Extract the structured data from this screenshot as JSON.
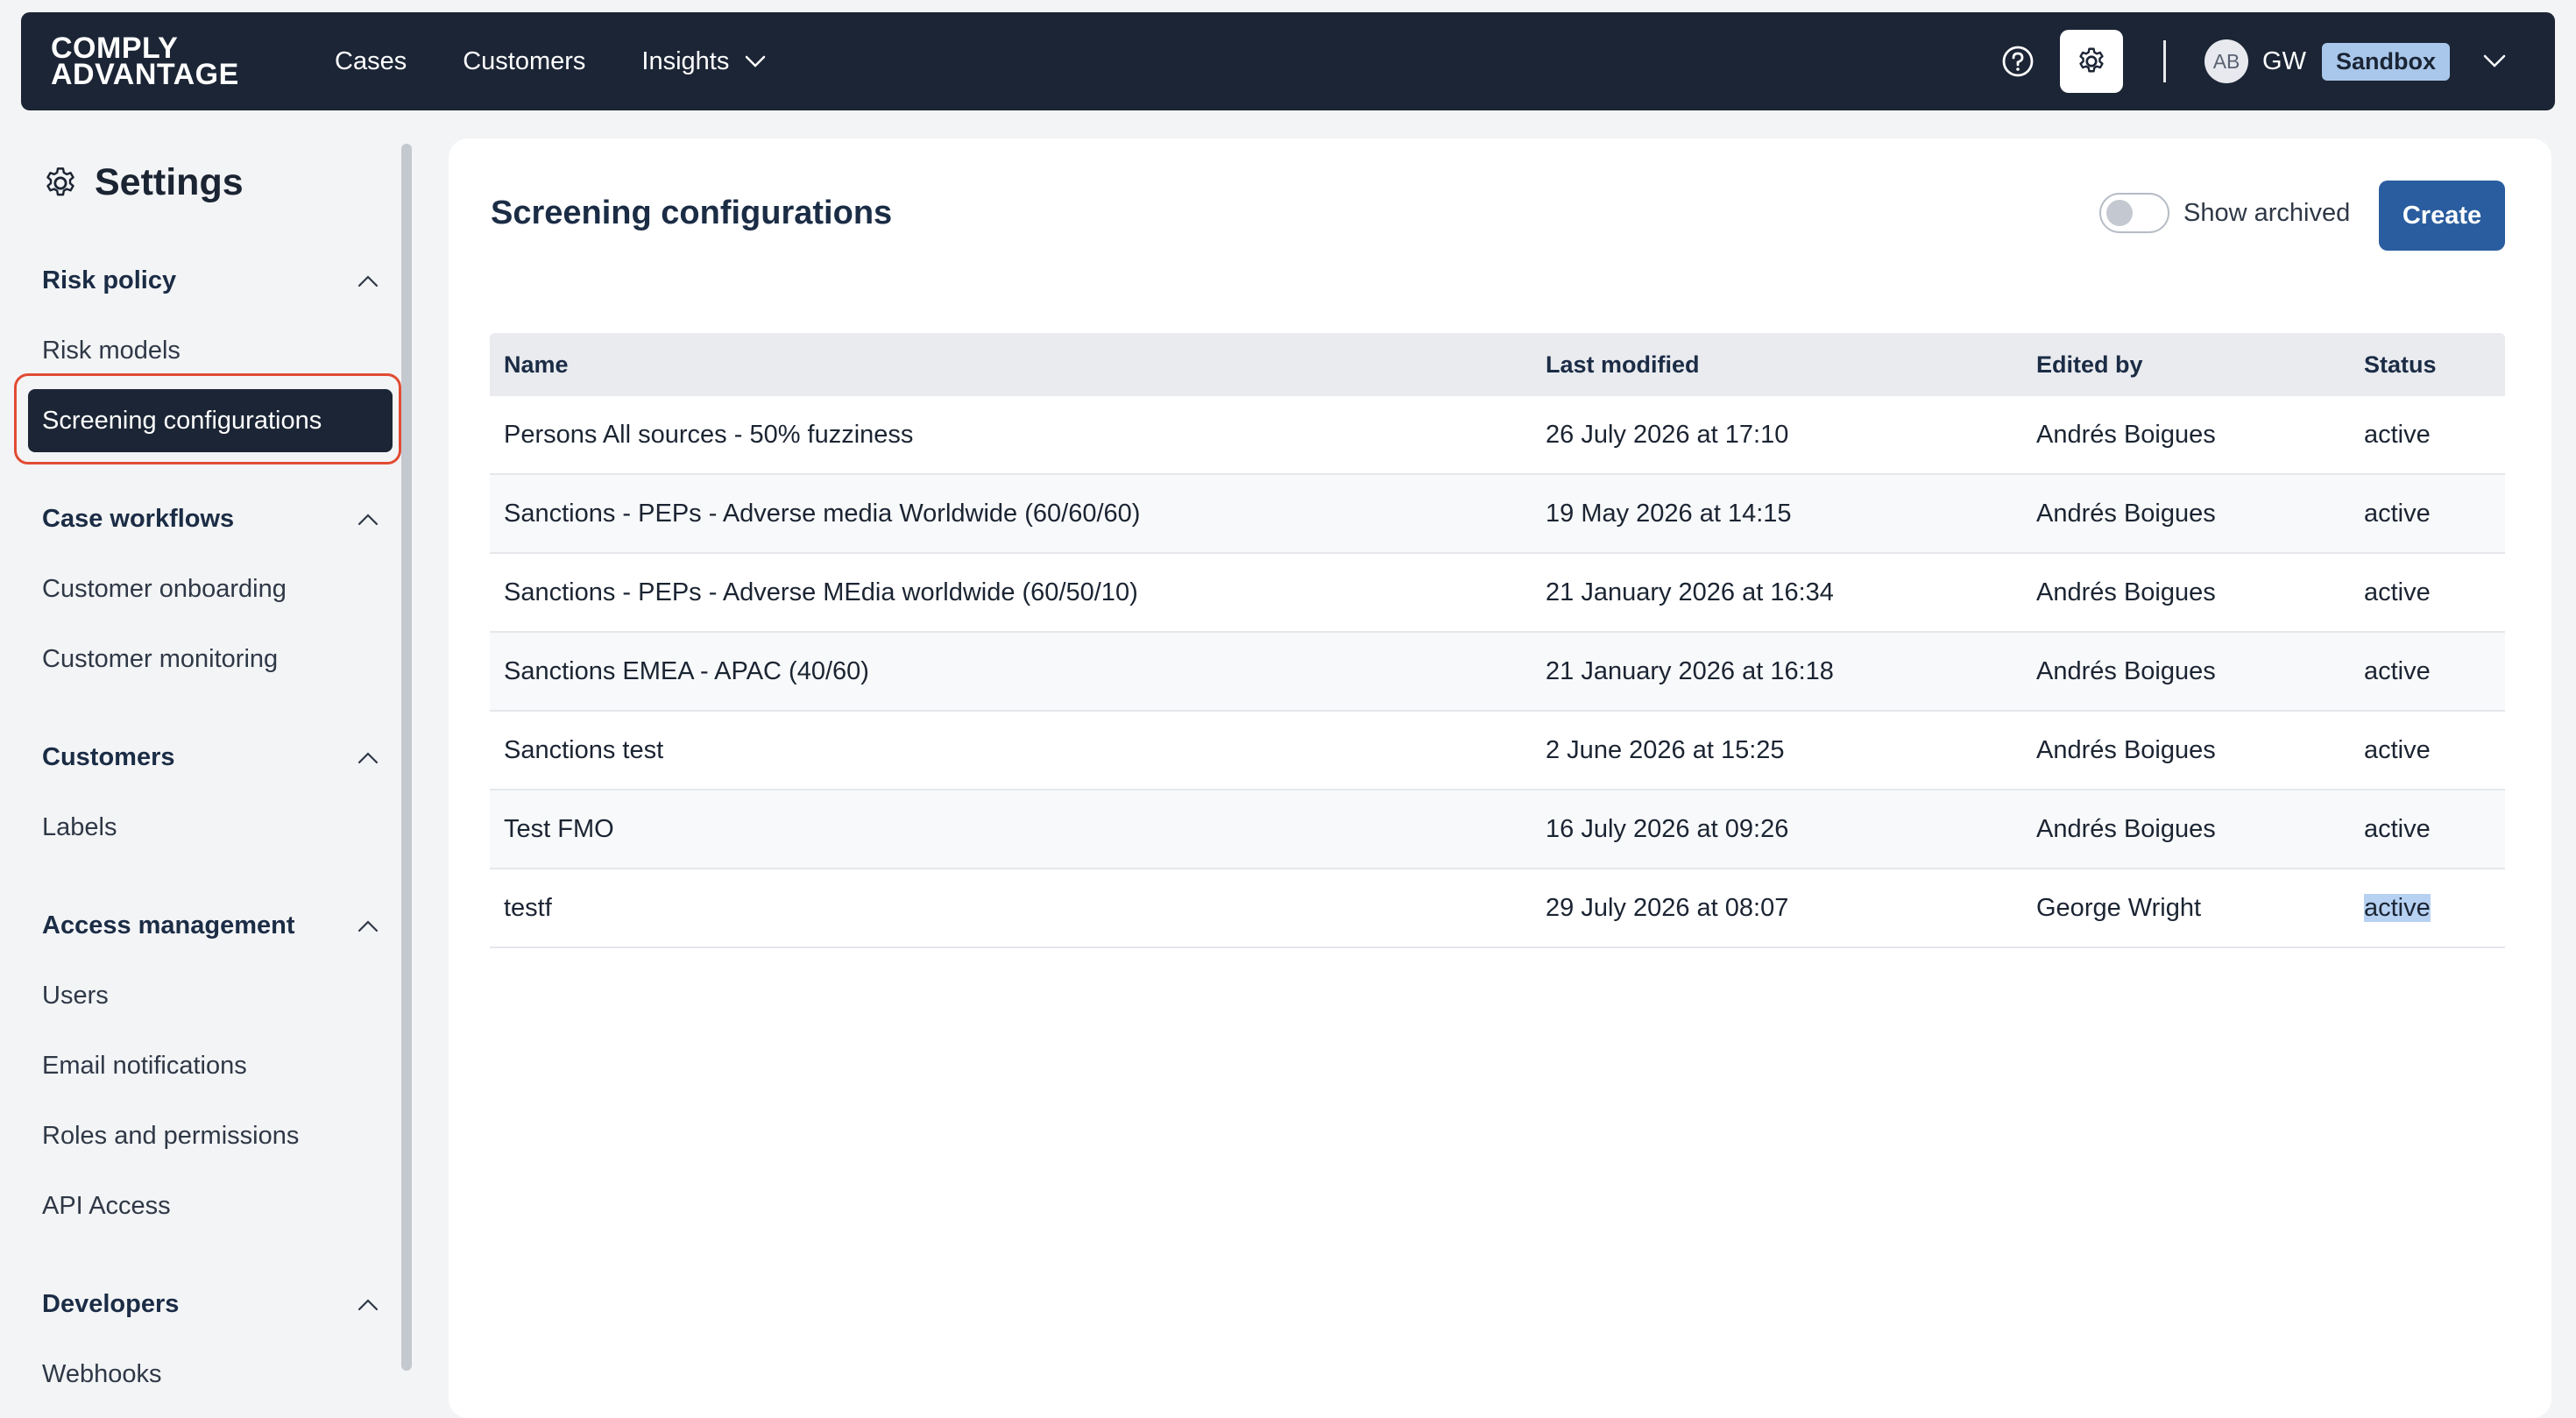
{
  "header": {
    "logo_line1": "COMPLY",
    "logo_line2": "ADVANTAGE",
    "nav": [
      {
        "label": "Cases"
      },
      {
        "label": "Customers"
      },
      {
        "label": "Insights"
      }
    ],
    "help_icon": "help-circle-icon",
    "settings_icon": "gear-icon",
    "user": {
      "avatar_initials": "AB",
      "initials": "GW",
      "environment": "Sandbox"
    }
  },
  "sidebar": {
    "title": "Settings",
    "sections": [
      {
        "label": "Risk policy",
        "items": [
          "Risk models",
          "Screening configurations"
        ]
      },
      {
        "label": "Case workflows",
        "items": [
          "Customer onboarding",
          "Customer monitoring"
        ]
      },
      {
        "label": "Customers",
        "items": [
          "Labels"
        ]
      },
      {
        "label": "Access management",
        "items": [
          "Users",
          "Email notifications",
          "Roles and permissions",
          "API Access"
        ]
      },
      {
        "label": "Developers",
        "items": [
          "Webhooks"
        ]
      }
    ],
    "selected_item": "Screening configurations"
  },
  "main": {
    "title": "Screening configurations",
    "show_archived_label": "Show archived",
    "show_archived": false,
    "create_label": "Create",
    "table": {
      "columns": [
        "Name",
        "Last modified",
        "Edited by",
        "Status"
      ],
      "rows": [
        [
          "Persons All sources - 50% fuzziness",
          "26 July 2026 at 17:10",
          "Andrés Boigues",
          "active"
        ],
        [
          "Sanctions - PEPs - Adverse media Worldwide (60/60/60)",
          "19 May 2026 at 14:15",
          "Andrés Boigues",
          "active"
        ],
        [
          "Sanctions - PEPs - Adverse MEdia worldwide (60/50/10)",
          "21 January 2026 at 16:34",
          "Andrés Boigues",
          "active"
        ],
        [
          "Sanctions EMEA - APAC (40/60)",
          "21 January 2026 at 16:18",
          "Andrés Boigues",
          "active"
        ],
        [
          "Sanctions test",
          "2 June 2026 at 15:25",
          "Andrés Boigues",
          "active"
        ],
        [
          "Test FMO",
          "16 July 2026 at 09:26",
          "Andrés Boigues",
          "active"
        ],
        [
          "testf",
          "29 July 2026 at 08:07",
          "George Wright",
          "active"
        ]
      ]
    }
  },
  "colors": {
    "navbar": "#1b2535",
    "accent": "#2a5d9f",
    "selection_ring": "#e24b33",
    "env_badge": "#a9c7ea"
  }
}
